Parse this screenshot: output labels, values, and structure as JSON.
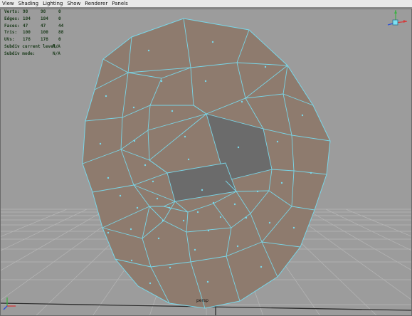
{
  "menu": [
    "View",
    "Shading",
    "Lighting",
    "Show",
    "Renderer",
    "Panels"
  ],
  "hud": {
    "rows": [
      {
        "label": "Verts:",
        "v1": "98",
        "v2": "98",
        "v3": "0"
      },
      {
        "label": "Edges:",
        "v1": "184",
        "v2": "184",
        "v3": "0"
      },
      {
        "label": "Faces:",
        "v1": "47",
        "v2": "47",
        "v3": "44"
      },
      {
        "label": "Tris:",
        "v1": "100",
        "v2": "100",
        "v3": "88"
      },
      {
        "label": "UVs:",
        "v1": "178",
        "v2": "178",
        "v3": "0"
      }
    ],
    "subdiv_level_label": "Subdiv current level:",
    "subdiv_level_value": "N/A",
    "subdiv_mode_label": "Subdiv mode:",
    "subdiv_mode_value": "N/A"
  },
  "camera": "persp",
  "colors": {
    "viewport_bg": "#9c9c9c",
    "mesh_face": "#8f7c6f",
    "mesh_edge": "#79d6e8",
    "selected_face": "#6a6a6a",
    "grid": "#b4b4b4",
    "grid_dark": "#3b3b3b",
    "axis_x": "#d43a3a",
    "axis_y": "#3cb043",
    "axis_z": "#2a4fd8"
  }
}
